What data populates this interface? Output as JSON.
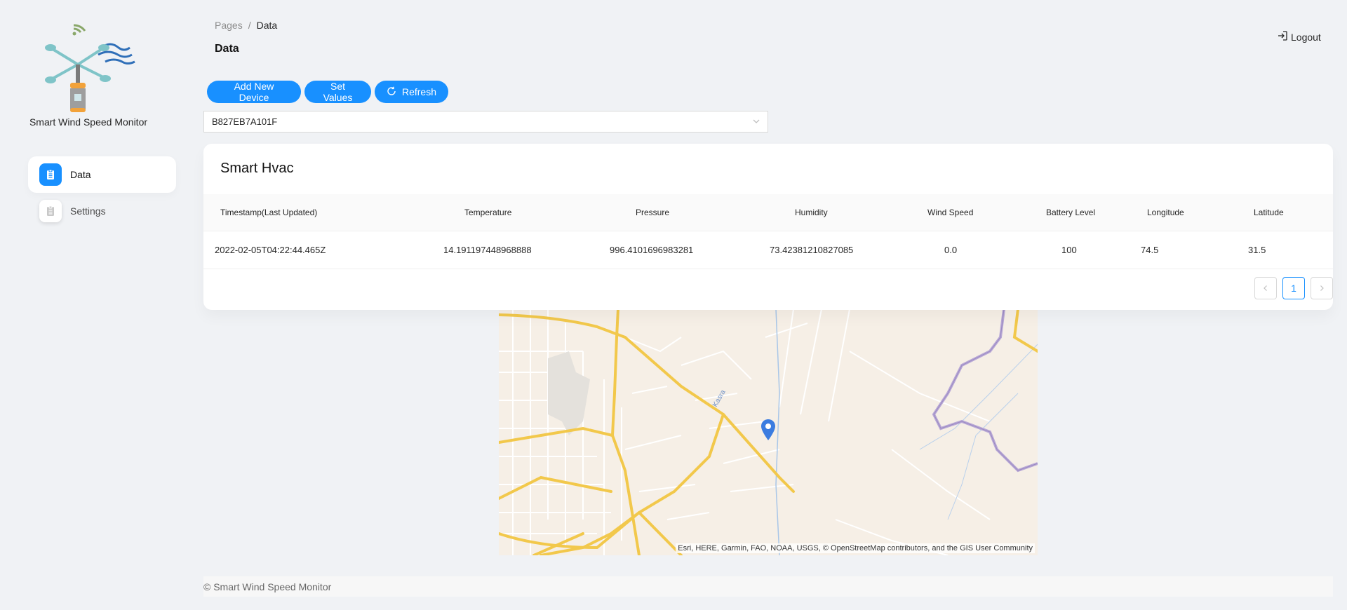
{
  "app": {
    "name": "Smart Wind Speed Monitor"
  },
  "sidebar": {
    "items": [
      {
        "label": "Data",
        "icon": "clipboard-icon",
        "active": true
      },
      {
        "label": "Settings",
        "icon": "clipboard-icon",
        "active": false
      }
    ]
  },
  "header": {
    "breadcrumb": {
      "root": "Pages",
      "separator": "/",
      "current": "Data"
    },
    "title": "Data",
    "logout_label": "Logout"
  },
  "toolbar": {
    "add_device_label": "Add New Device",
    "set_values_label": "Set Values",
    "refresh_label": "Refresh"
  },
  "device_select": {
    "value": "B827EB7A101F"
  },
  "card": {
    "title": "Smart Hvac",
    "columns": [
      "Timestamp(Last Updated)",
      "Temperature",
      "Pressure",
      "Humidity",
      "Wind Speed",
      "Battery Level",
      "Longitude",
      "Latitude"
    ],
    "rows": [
      [
        "2022-02-05T04:22:44.465Z",
        "14.191197448968888",
        "996.4101696983281",
        "73.42381210827085",
        "0.0",
        "100",
        "74.5",
        "31.5"
      ]
    ]
  },
  "pagination": {
    "current_page": "1",
    "prev": "<",
    "next": ">"
  },
  "map": {
    "attribution": "Esri, HERE, Garmin, FAO, NOAA, USGS, © OpenStreetMap contributors, and the GIS User Community",
    "road_label": "Kasra"
  },
  "footer": {
    "text": "© Smart Wind Speed Monitor"
  },
  "colors": {
    "primary": "#1890ff",
    "background": "#f0f2f5"
  }
}
